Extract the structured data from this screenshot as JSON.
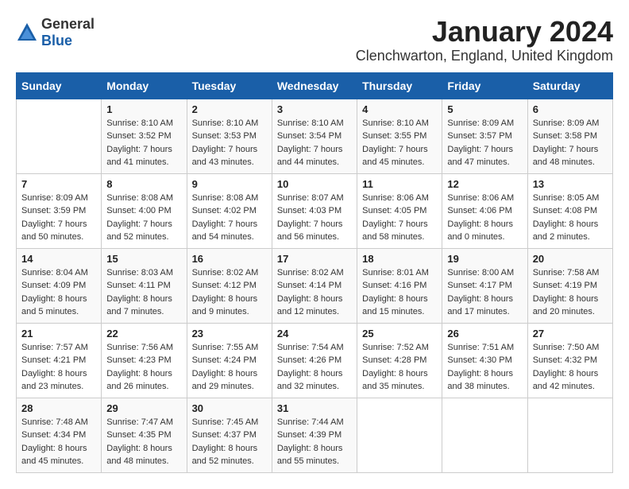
{
  "logo": {
    "general": "General",
    "blue": "Blue"
  },
  "title": "January 2024",
  "location": "Clenchwarton, England, United Kingdom",
  "weekdays": [
    "Sunday",
    "Monday",
    "Tuesday",
    "Wednesday",
    "Thursday",
    "Friday",
    "Saturday"
  ],
  "weeks": [
    [
      {
        "day": "",
        "info": ""
      },
      {
        "day": "1",
        "info": "Sunrise: 8:10 AM\nSunset: 3:52 PM\nDaylight: 7 hours\nand 41 minutes."
      },
      {
        "day": "2",
        "info": "Sunrise: 8:10 AM\nSunset: 3:53 PM\nDaylight: 7 hours\nand 43 minutes."
      },
      {
        "day": "3",
        "info": "Sunrise: 8:10 AM\nSunset: 3:54 PM\nDaylight: 7 hours\nand 44 minutes."
      },
      {
        "day": "4",
        "info": "Sunrise: 8:10 AM\nSunset: 3:55 PM\nDaylight: 7 hours\nand 45 minutes."
      },
      {
        "day": "5",
        "info": "Sunrise: 8:09 AM\nSunset: 3:57 PM\nDaylight: 7 hours\nand 47 minutes."
      },
      {
        "day": "6",
        "info": "Sunrise: 8:09 AM\nSunset: 3:58 PM\nDaylight: 7 hours\nand 48 minutes."
      }
    ],
    [
      {
        "day": "7",
        "info": "Sunrise: 8:09 AM\nSunset: 3:59 PM\nDaylight: 7 hours\nand 50 minutes."
      },
      {
        "day": "8",
        "info": "Sunrise: 8:08 AM\nSunset: 4:00 PM\nDaylight: 7 hours\nand 52 minutes."
      },
      {
        "day": "9",
        "info": "Sunrise: 8:08 AM\nSunset: 4:02 PM\nDaylight: 7 hours\nand 54 minutes."
      },
      {
        "day": "10",
        "info": "Sunrise: 8:07 AM\nSunset: 4:03 PM\nDaylight: 7 hours\nand 56 minutes."
      },
      {
        "day": "11",
        "info": "Sunrise: 8:06 AM\nSunset: 4:05 PM\nDaylight: 7 hours\nand 58 minutes."
      },
      {
        "day": "12",
        "info": "Sunrise: 8:06 AM\nSunset: 4:06 PM\nDaylight: 8 hours\nand 0 minutes."
      },
      {
        "day": "13",
        "info": "Sunrise: 8:05 AM\nSunset: 4:08 PM\nDaylight: 8 hours\nand 2 minutes."
      }
    ],
    [
      {
        "day": "14",
        "info": "Sunrise: 8:04 AM\nSunset: 4:09 PM\nDaylight: 8 hours\nand 5 minutes."
      },
      {
        "day": "15",
        "info": "Sunrise: 8:03 AM\nSunset: 4:11 PM\nDaylight: 8 hours\nand 7 minutes."
      },
      {
        "day": "16",
        "info": "Sunrise: 8:02 AM\nSunset: 4:12 PM\nDaylight: 8 hours\nand 9 minutes."
      },
      {
        "day": "17",
        "info": "Sunrise: 8:02 AM\nSunset: 4:14 PM\nDaylight: 8 hours\nand 12 minutes."
      },
      {
        "day": "18",
        "info": "Sunrise: 8:01 AM\nSunset: 4:16 PM\nDaylight: 8 hours\nand 15 minutes."
      },
      {
        "day": "19",
        "info": "Sunrise: 8:00 AM\nSunset: 4:17 PM\nDaylight: 8 hours\nand 17 minutes."
      },
      {
        "day": "20",
        "info": "Sunrise: 7:58 AM\nSunset: 4:19 PM\nDaylight: 8 hours\nand 20 minutes."
      }
    ],
    [
      {
        "day": "21",
        "info": "Sunrise: 7:57 AM\nSunset: 4:21 PM\nDaylight: 8 hours\nand 23 minutes."
      },
      {
        "day": "22",
        "info": "Sunrise: 7:56 AM\nSunset: 4:23 PM\nDaylight: 8 hours\nand 26 minutes."
      },
      {
        "day": "23",
        "info": "Sunrise: 7:55 AM\nSunset: 4:24 PM\nDaylight: 8 hours\nand 29 minutes."
      },
      {
        "day": "24",
        "info": "Sunrise: 7:54 AM\nSunset: 4:26 PM\nDaylight: 8 hours\nand 32 minutes."
      },
      {
        "day": "25",
        "info": "Sunrise: 7:52 AM\nSunset: 4:28 PM\nDaylight: 8 hours\nand 35 minutes."
      },
      {
        "day": "26",
        "info": "Sunrise: 7:51 AM\nSunset: 4:30 PM\nDaylight: 8 hours\nand 38 minutes."
      },
      {
        "day": "27",
        "info": "Sunrise: 7:50 AM\nSunset: 4:32 PM\nDaylight: 8 hours\nand 42 minutes."
      }
    ],
    [
      {
        "day": "28",
        "info": "Sunrise: 7:48 AM\nSunset: 4:34 PM\nDaylight: 8 hours\nand 45 minutes."
      },
      {
        "day": "29",
        "info": "Sunrise: 7:47 AM\nSunset: 4:35 PM\nDaylight: 8 hours\nand 48 minutes."
      },
      {
        "day": "30",
        "info": "Sunrise: 7:45 AM\nSunset: 4:37 PM\nDaylight: 8 hours\nand 52 minutes."
      },
      {
        "day": "31",
        "info": "Sunrise: 7:44 AM\nSunset: 4:39 PM\nDaylight: 8 hours\nand 55 minutes."
      },
      {
        "day": "",
        "info": ""
      },
      {
        "day": "",
        "info": ""
      },
      {
        "day": "",
        "info": ""
      }
    ]
  ]
}
